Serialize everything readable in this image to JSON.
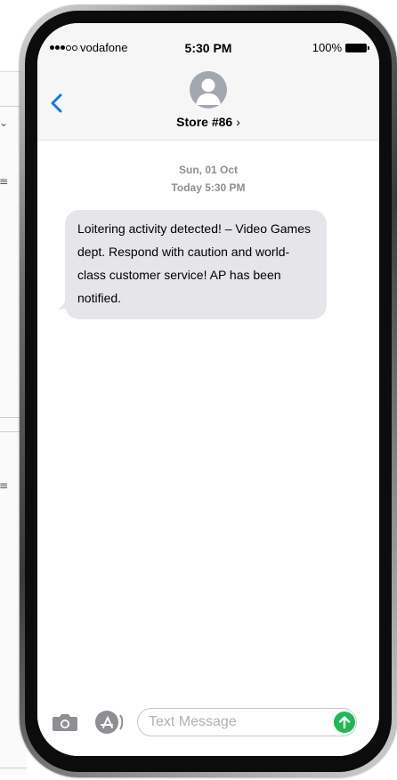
{
  "status_bar": {
    "carrier": "vodafone",
    "time": "5:30 PM",
    "battery": "100%"
  },
  "header": {
    "contact_name": "Store #86",
    "contact_chevron": "›"
  },
  "thread": {
    "date": "Sun, 01 Oct",
    "time": "Today 5:30 PM",
    "messages": [
      {
        "direction": "incoming",
        "text": "Loitering activity detected! – Video Games dept. Respond with caution and world-class customer service! AP has been notified."
      }
    ]
  },
  "input_bar": {
    "placeholder": "Text Message"
  },
  "icons": {
    "back": "back-chevron-icon",
    "avatar": "person-icon",
    "camera": "camera-icon",
    "apps": "app-store-icon",
    "send": "send-arrow-icon",
    "battery": "battery-icon",
    "signal": "signal-dots-icon"
  },
  "colors": {
    "accent": "#007aff",
    "incoming_bubble": "#e5e5ea",
    "send_button": "#1db954",
    "header_bg": "#f6f6f6",
    "meta_text": "#8e8e93"
  }
}
